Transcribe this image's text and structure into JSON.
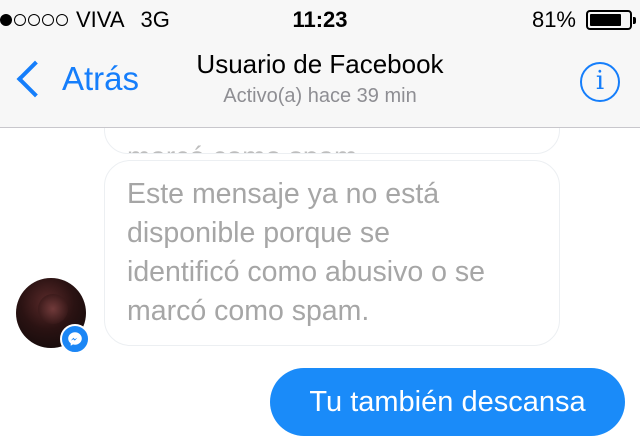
{
  "status_bar": {
    "carrier": "VIVA",
    "network": "3G",
    "time": "11:23",
    "battery_percent": "81%",
    "battery_level": 0.81,
    "signal_bars_filled": 1,
    "signal_bars_total": 5
  },
  "nav": {
    "back_label": "Atrás",
    "title": "Usuario de Facebook",
    "subtitle": "Activo(a) hace 39 min",
    "info_glyph": "i"
  },
  "messages": {
    "previous_partial": "marcó como spam.",
    "received_lines": [
      "Este mensaje ya no está",
      "disponible porque se",
      "identificó como abusivo o se",
      "marcó como spam."
    ],
    "sent": "Tu también descansa"
  },
  "colors": {
    "accent": "#157efb",
    "sent_bubble": "#1a8bf9",
    "received_text": "#a6a6a6",
    "bar_background": "#f7f7f7"
  },
  "icons": {
    "back": "chevron-left-icon",
    "info": "info-icon",
    "battery": "battery-icon",
    "badge": "messenger-icon"
  }
}
